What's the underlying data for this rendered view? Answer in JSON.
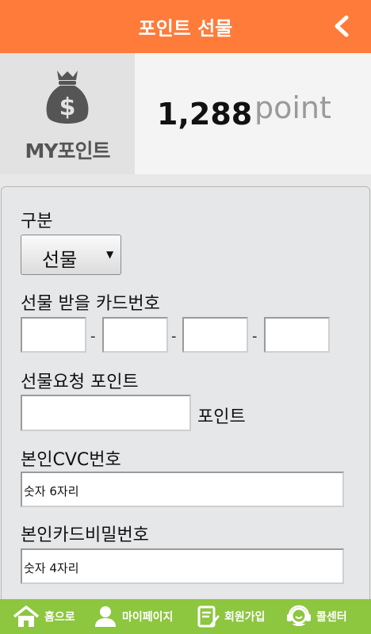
{
  "header": {
    "title": "포인트 선물",
    "back_icon": "chevron-left-icon"
  },
  "mypoint": {
    "label": "MY포인트",
    "icon": "money-bag-icon",
    "value": "1,288",
    "unit": "point"
  },
  "form": {
    "category_label": "구분",
    "category_value": "선물",
    "card_label": "선물 받을 카드번호",
    "card_separator": "-",
    "points_label": "선물요청 포인트",
    "points_unit": "포인트",
    "cvc_label": "본인CVC번호",
    "cvc_value": "숫자 6자리",
    "password_label": "본인카드비밀번호",
    "password_value": "숫자 4자리"
  },
  "nav": {
    "home": "홈으로",
    "mypage": "마이페이지",
    "join": "회원가입",
    "callcenter": "콜센터"
  },
  "colors": {
    "header": "#ff7b3a",
    "footer": "#8dc63f"
  }
}
